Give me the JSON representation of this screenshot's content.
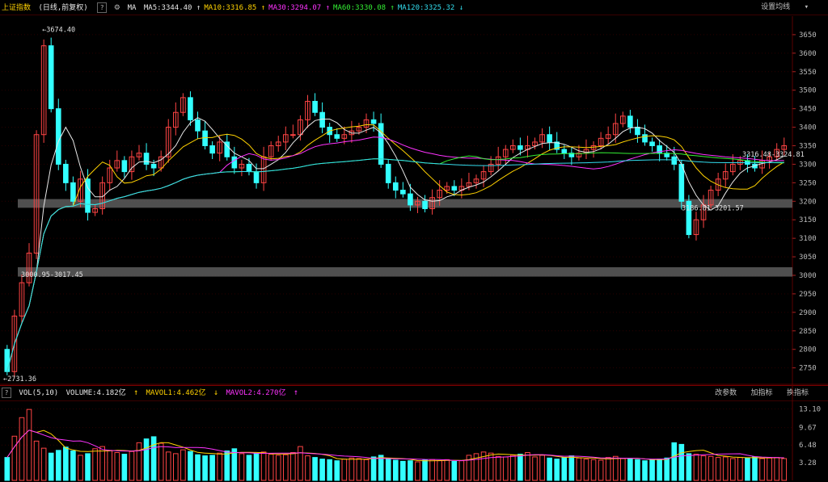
{
  "header": {
    "index_name": "上证指数",
    "mode": "(日线,前复权)",
    "help": "?",
    "ma_label": "MA",
    "ma_items": [
      {
        "text": "MA5:3344.40",
        "arrow": "↑",
        "color": "#e8e8e8"
      },
      {
        "text": "MA10:3316.85",
        "arrow": "↑",
        "color": "#ffd200"
      },
      {
        "text": "MA30:3294.07",
        "arrow": "↑",
        "color": "#ff33ff"
      },
      {
        "text": "MA60:3330.08",
        "arrow": "↑",
        "color": "#33ee33"
      },
      {
        "text": "MA120:3325.32",
        "arrow": "↓",
        "color": "#33ddee"
      }
    ],
    "settings": "设置均线"
  },
  "volume_header": {
    "label": "VOL(5,10)",
    "volume": "VOLUME:4.182亿",
    "volume_arrow": "↑",
    "mavol1": "MAVOL1:4.462亿",
    "mavol1_arrow": "↓",
    "mavol2": "MAVOL2:4.270亿",
    "mavol2_arrow": "↑",
    "tools": [
      "改参数",
      "加指标",
      "换指标"
    ],
    "help": "?"
  },
  "colors": {
    "up": "#ff4444",
    "down": "#33ffff",
    "ma5": "#e8e8e8",
    "ma10": "#ffd200",
    "ma30": "#ff33ff",
    "ma60": "#33ee33",
    "ma120": "#33ddee"
  },
  "chart_data": {
    "type": "candlestick",
    "price_axis": {
      "ticks": [
        2750,
        2800,
        2850,
        2900,
        2950,
        3000,
        3050,
        3100,
        3150,
        3200,
        3250,
        3300,
        3350,
        3400,
        3450,
        3500,
        3550,
        3600,
        3650
      ],
      "ylim": [
        2710,
        3700
      ]
    },
    "volume_axis": {
      "ticks": [
        "13.10",
        "9.67",
        "6.48",
        "3.28"
      ],
      "ylim": [
        0,
        14.5
      ]
    },
    "annotations": {
      "high": "3674.40",
      "low": "2731.36",
      "band_low": "3000.95-3017.45",
      "band_mid": "3186.81-3201.57",
      "last_level": "3316.48",
      "last_level_2": "3324.81"
    },
    "closes": [
      2740,
      2890,
      2980,
      3060,
      3380,
      3620,
      3450,
      3300,
      3250,
      3200,
      3260,
      3170,
      3180,
      3250,
      3290,
      3310,
      3280,
      3320,
      3330,
      3300,
      3290,
      3320,
      3400,
      3440,
      3480,
      3420,
      3390,
      3350,
      3330,
      3360,
      3320,
      3290,
      3300,
      3280,
      3250,
      3320,
      3350,
      3360,
      3380,
      3380,
      3420,
      3470,
      3440,
      3400,
      3380,
      3370,
      3380,
      3390,
      3400,
      3420,
      3410,
      3300,
      3250,
      3230,
      3220,
      3190,
      3200,
      3180,
      3210,
      3230,
      3240,
      3230,
      3240,
      3250,
      3260,
      3280,
      3300,
      3320,
      3340,
      3350,
      3340,
      3350,
      3360,
      3380,
      3360,
      3340,
      3330,
      3320,
      3330,
      3340,
      3350,
      3370,
      3380,
      3410,
      3430,
      3400,
      3380,
      3360,
      3350,
      3330,
      3320,
      3300,
      3200,
      3110,
      3150,
      3190,
      3230,
      3260,
      3280,
      3300,
      3310,
      3300,
      3290,
      3310,
      3320,
      3340,
      3350
    ],
    "volumes": [
      4.2,
      8.1,
      11.5,
      13.0,
      7.2,
      5.9,
      5.0,
      5.5,
      6.1,
      5.4,
      4.6,
      4.9,
      5.8,
      6.2,
      5.5,
      5.1,
      4.8,
      5.3,
      6.9,
      7.6,
      8.0,
      6.8,
      5.2,
      4.9,
      5.6,
      5.3,
      4.7,
      4.5,
      4.6,
      5.0,
      5.4,
      5.8,
      4.9,
      4.6,
      4.9,
      5.2,
      4.8,
      4.6,
      4.7,
      5.1,
      6.2,
      4.5,
      4.2,
      3.9,
      3.8,
      3.6,
      3.9,
      4.1,
      4.0,
      3.8,
      4.3,
      4.6,
      3.9,
      3.7,
      3.5,
      3.6,
      3.4,
      3.7,
      3.8,
      3.6,
      3.8,
      3.5,
      3.6,
      4.6,
      4.9,
      5.2,
      5.0,
      4.4,
      4.3,
      4.6,
      4.8,
      5.1,
      4.3,
      4.6,
      4.1,
      3.9,
      4.2,
      4.5,
      4.1,
      3.9,
      3.8,
      3.7,
      4.2,
      4.4,
      4.0,
      3.9,
      3.8,
      3.6,
      3.8,
      3.9,
      4.1,
      6.9,
      6.6,
      4.9,
      4.8,
      4.5,
      4.4,
      4.2,
      4.3,
      4.0,
      4.2,
      4.1,
      4.3,
      4.0,
      4.1,
      4.2,
      4.0
    ]
  }
}
